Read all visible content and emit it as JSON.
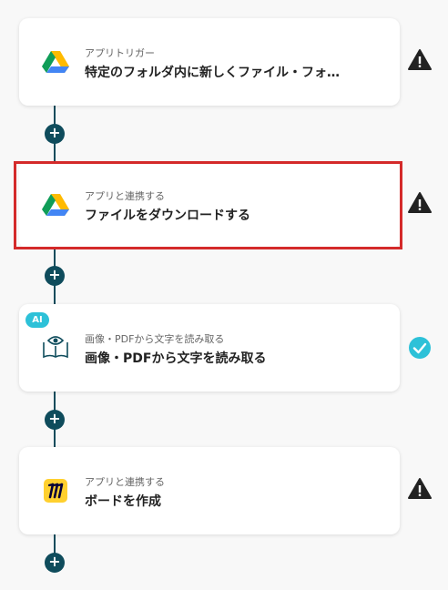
{
  "steps": [
    {
      "subtitle": "アプリトリガー",
      "title": "特定のフォルダ内に新しくファイル・フォ…",
      "icon": "google-drive-icon",
      "status": "warning"
    },
    {
      "subtitle": "アプリと連携する",
      "title": "ファイルをダウンロードする",
      "icon": "google-drive-icon",
      "status": "warning",
      "selected": true
    },
    {
      "subtitle": "画像・PDFから文字を読み取る",
      "title": "画像・PDFから文字を読み取る",
      "icon": "ocr-book-icon",
      "badge": "AI",
      "status": "complete"
    },
    {
      "subtitle": "アプリと連携する",
      "title": "ボードを作成",
      "icon": "miro-icon",
      "status": "warning"
    }
  ],
  "add_button_label": "+",
  "colors": {
    "connector": "#0f4c5c",
    "selection": "#d42a2a",
    "complete": "#2dc1d8",
    "warning": "#222222"
  }
}
